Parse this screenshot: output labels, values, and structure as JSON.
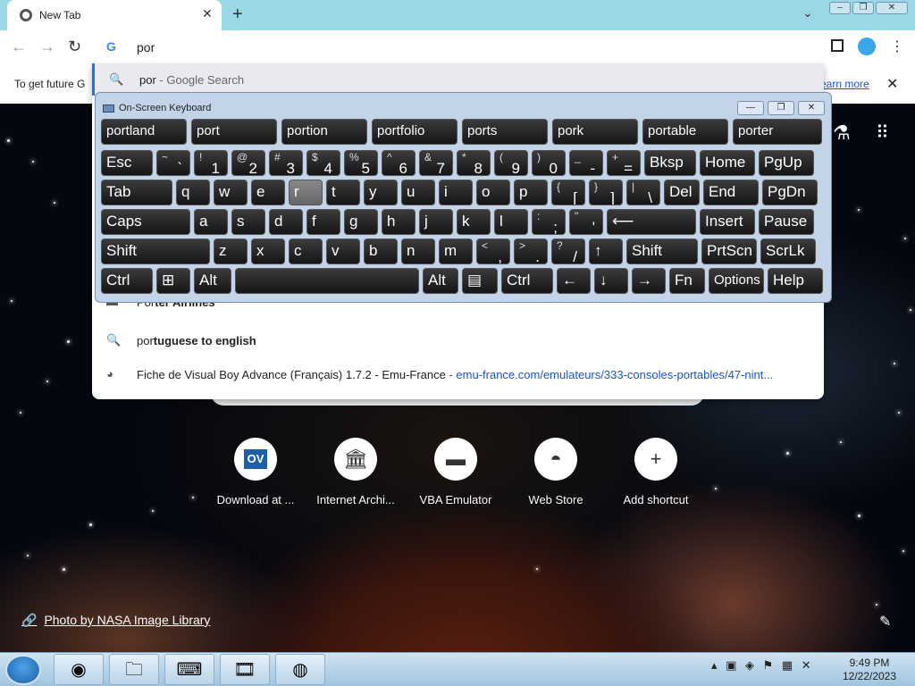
{
  "browser": {
    "tab_title": "New Tab",
    "tab_close": "✕",
    "new_tab": "+",
    "omnibox_query": "por",
    "infobar_text": "To get future G",
    "infobar_link": "earn more",
    "infobar_close": "✕"
  },
  "suggestions": [
    {
      "icon": "search-icon",
      "prefix": "por",
      "rest": " - Google Search",
      "url": ""
    },
    {
      "icon": "site-icon",
      "prefix": "Por",
      "rest": "ter Airlines",
      "url": ""
    },
    {
      "icon": "search-icon",
      "prefix": "por",
      "rest": "tuguese to english",
      "url": ""
    },
    {
      "icon": "vba-icon",
      "prefix": "",
      "rest": "Fiche de Visual Boy Advance (Français) 1.7.2 - Emu-France",
      "url": "emu-france.com/emulateurs/333-consoles-portables/47-nint..."
    }
  ],
  "keyboard": {
    "title": "On-Screen Keyboard",
    "predictions": [
      "portland",
      "port",
      "portion",
      "portfolio",
      "ports",
      "pork",
      "portable",
      "porter"
    ],
    "row1": [
      {
        "label": "Esc"
      },
      {
        "s": "~",
        "m": "`"
      },
      {
        "s": "!",
        "m": "1"
      },
      {
        "s": "@",
        "m": "2"
      },
      {
        "s": "#",
        "m": "3"
      },
      {
        "s": "$",
        "m": "4"
      },
      {
        "s": "%",
        "m": "5"
      },
      {
        "s": "^",
        "m": "6"
      },
      {
        "s": "&",
        "m": "7"
      },
      {
        "s": "*",
        "m": "8"
      },
      {
        "s": "(",
        "m": "9"
      },
      {
        "s": ")",
        "m": "0"
      },
      {
        "s": "_",
        "m": "-"
      },
      {
        "s": "+",
        "m": "="
      },
      {
        "label": "Bksp"
      },
      {
        "label": "Home"
      },
      {
        "label": "PgUp"
      }
    ],
    "row2": [
      {
        "label": "Tab"
      },
      {
        "label": "q"
      },
      {
        "label": "w"
      },
      {
        "label": "e"
      },
      {
        "label": "r"
      },
      {
        "label": "t"
      },
      {
        "label": "y"
      },
      {
        "label": "u"
      },
      {
        "label": "i"
      },
      {
        "label": "o"
      },
      {
        "label": "p"
      },
      {
        "s": "{",
        "m": "["
      },
      {
        "s": "}",
        "m": "]"
      },
      {
        "s": "|",
        "m": "\\"
      },
      {
        "label": "Del"
      },
      {
        "label": "End"
      },
      {
        "label": "PgDn"
      }
    ],
    "row3": [
      {
        "label": "Caps"
      },
      {
        "label": "a"
      },
      {
        "label": "s"
      },
      {
        "label": "d"
      },
      {
        "label": "f"
      },
      {
        "label": "g"
      },
      {
        "label": "h"
      },
      {
        "label": "j"
      },
      {
        "label": "k"
      },
      {
        "label": "l"
      },
      {
        "s": ":",
        "m": ";"
      },
      {
        "s": "\"",
        "m": "'"
      },
      {
        "label": "⟵"
      },
      {
        "label": "Insert"
      },
      {
        "label": "Pause"
      }
    ],
    "row4": [
      {
        "label": "Shift"
      },
      {
        "label": "z"
      },
      {
        "label": "x"
      },
      {
        "label": "c"
      },
      {
        "label": "v"
      },
      {
        "label": "b"
      },
      {
        "label": "n"
      },
      {
        "label": "m"
      },
      {
        "s": "<",
        "m": ","
      },
      {
        "s": ">",
        "m": "."
      },
      {
        "s": "?",
        "m": "/"
      },
      {
        "label": "↑"
      },
      {
        "label": "Shift"
      },
      {
        "label": "PrtScn"
      },
      {
        "label": "ScrLk"
      }
    ],
    "row5": [
      {
        "label": "Ctrl"
      },
      {
        "label": "⊞"
      },
      {
        "label": "Alt"
      },
      {
        "label": ""
      },
      {
        "label": "Alt"
      },
      {
        "label": "▤"
      },
      {
        "label": "Ctrl"
      },
      {
        "label": "←"
      },
      {
        "label": "↓"
      },
      {
        "label": "→"
      },
      {
        "label": "Fn"
      },
      {
        "label": "Options"
      },
      {
        "label": "Help"
      }
    ],
    "pressed_key": "r"
  },
  "shortcuts": [
    {
      "label": "Download at ...",
      "glyph": "OV"
    },
    {
      "label": "Internet Archi...",
      "glyph": "🏛"
    },
    {
      "label": "VBA Emulator",
      "glyph": "▬"
    },
    {
      "label": "Web Store",
      "glyph": "◓"
    },
    {
      "label": "Add shortcut",
      "glyph": "+"
    }
  ],
  "photo_credit": "Photo by NASA Image Library",
  "taskbar": {
    "time": "9:49 PM",
    "date": "12/22/2023"
  }
}
